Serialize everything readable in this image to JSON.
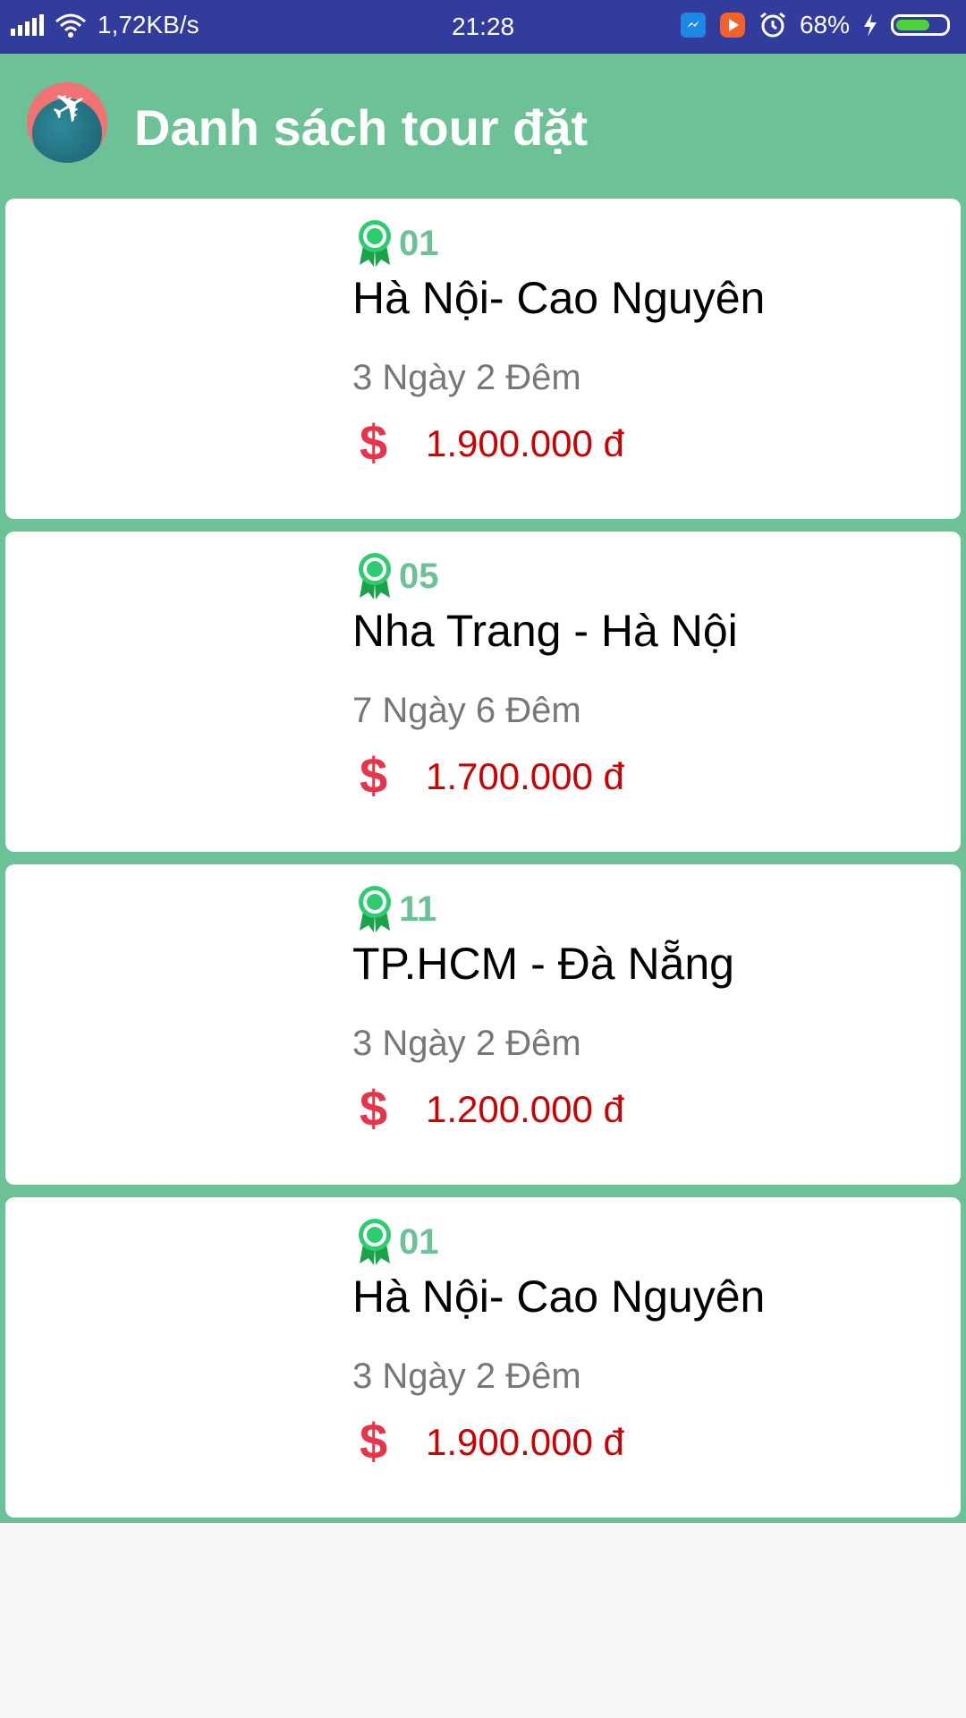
{
  "status_bar": {
    "speed": "1,72KB/s",
    "time": "21:28",
    "battery": "68%",
    "battery_level": 0.68
  },
  "app_bar": {
    "title": "Danh sách tour đặt",
    "logo_icon": "airplane-globe-icon"
  },
  "tours": [
    {
      "code": "01",
      "name": "Hà Nội- Cao Nguyên",
      "duration": "3 Ngày 2 Đêm",
      "price": "1.900.000 đ"
    },
    {
      "code": "05",
      "name": "Nha Trang - Hà Nội",
      "duration": "7 Ngày 6 Đêm",
      "price": "1.700.000 đ"
    },
    {
      "code": "11",
      "name": "TP.HCM - Đà Nẵng",
      "duration": "3 Ngày 2 Đêm",
      "price": "1.200.000 đ"
    },
    {
      "code": "01",
      "name": "Hà Nội- Cao Nguyên",
      "duration": "3 Ngày 2 Đêm",
      "price": "1.900.000 đ"
    }
  ],
  "icons": {
    "badge": "award-ribbon-icon",
    "currency": "dollar-icon"
  },
  "colors": {
    "status_bar": "#323c9c",
    "accent": "#6cc196",
    "price": "#cc0000",
    "dollar": "#e8344a"
  }
}
